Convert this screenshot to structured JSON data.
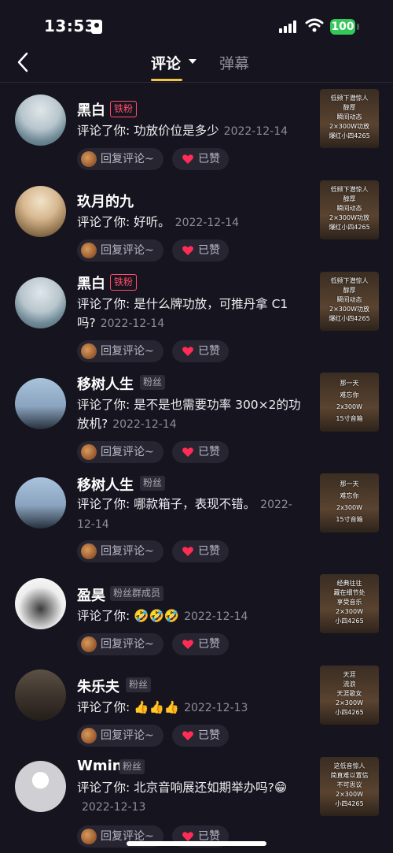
{
  "status": {
    "time": "13:53",
    "battery": "100"
  },
  "nav": {
    "tab_comment": "评论",
    "tab_danmu": "弹幕"
  },
  "reply_label": "回复评论~",
  "liked_label": "已赞",
  "comments": [
    {
      "name": "黑白",
      "badge": "铁粉",
      "text": "评论了你: 功放价位是多少",
      "date": "2022-12-14",
      "thumb_lines": [
        "低频下潜惊人",
        "醇厚",
        "瞬间动态",
        "2×300W功放",
        "爆红小四4265"
      ]
    },
    {
      "name": "玖月的九",
      "badge": "",
      "text": "评论了你: 好听。",
      "date": "2022-12-14",
      "thumb_lines": [
        "低频下潜惊人",
        "醇厚",
        "瞬间动态",
        "2×300W功放",
        "爆红小四4265"
      ]
    },
    {
      "name": "黑白",
      "badge": "铁粉",
      "text": "评论了你: 是什么牌功放，可推丹拿 C1吗?",
      "date": "2022-12-14",
      "thumb_lines": [
        "低频下潜惊人",
        "醇厚",
        "瞬间动态",
        "2×300W功放",
        "爆红小四4265"
      ]
    },
    {
      "name": "移树人生",
      "badge": "粉丝",
      "text": "评论了你: 是不是也需要功率 300×2的功放机?",
      "date": "2022-12-14",
      "thumb_lines": [
        "那一天",
        "难忘你",
        "2x300W",
        "15寸音箱"
      ]
    },
    {
      "name": "移树人生",
      "badge": "粉丝",
      "text": "评论了你: 哪款箱子，表现不错。",
      "date": "2022-12-14",
      "thumb_lines": [
        "那一天",
        "难忘你",
        "2x300W",
        "15寸音箱"
      ]
    },
    {
      "name": "盈昊",
      "badge": "粉丝群成员",
      "text": "评论了你: 🤣🤣🤣",
      "date": "2022-12-14",
      "thumb_lines": [
        "经典往往",
        "藏在细节处",
        "享受音乐",
        "2×300W",
        "小四4265"
      ]
    },
    {
      "name": "朱乐夫",
      "badge": "粉丝",
      "text": "评论了你: 👍👍👍",
      "date": "2022-12-13",
      "thumb_lines": [
        "天涯",
        "流浪",
        "天涯歌女",
        "2×300W",
        "小四4265"
      ]
    },
    {
      "name": "Wmin",
      "badge": "粉丝",
      "text": "评论了你: 北京音响展还如期举办吗?😁",
      "date": "2022-12-13",
      "thumb_lines": [
        "这低音惊人",
        "简直难以置信",
        "不可思议",
        "2×300W",
        "小四4265"
      ]
    }
  ]
}
